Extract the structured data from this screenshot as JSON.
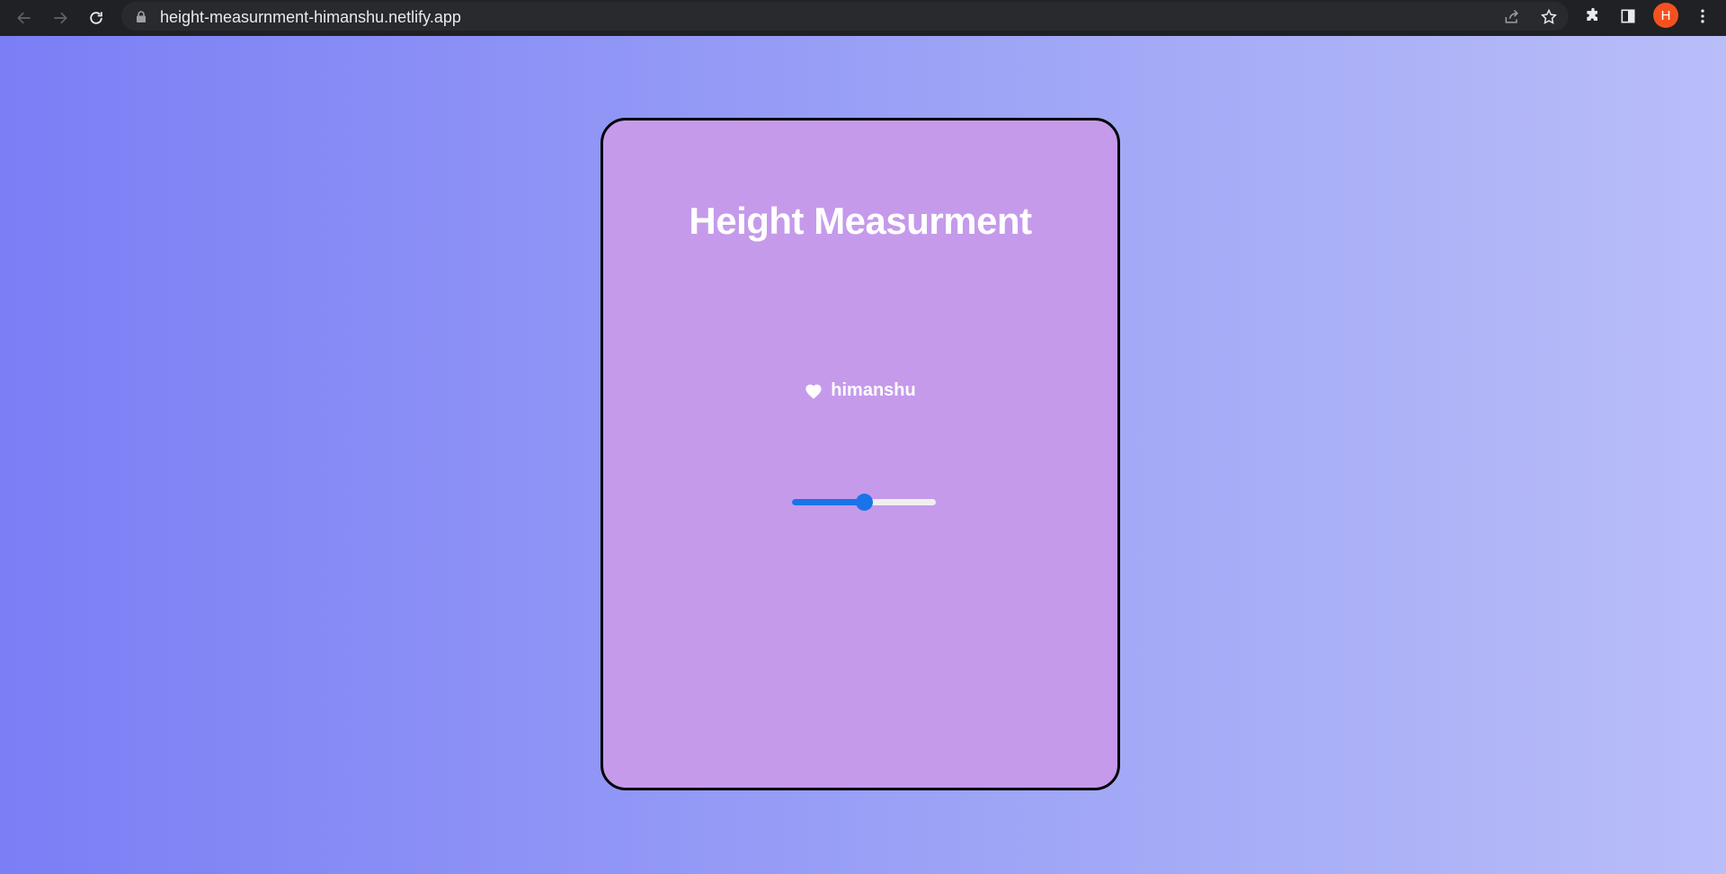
{
  "browser": {
    "url": "height-measurnment-himanshu.netlify.app",
    "profile_initial": "H",
    "icons": {
      "back": "arrow-left-icon",
      "forward": "arrow-right-icon",
      "reload": "reload-icon",
      "lock": "lock-icon",
      "share": "share-icon",
      "bookmark": "star-icon",
      "extensions": "puzzle-icon",
      "side_panel": "side-panel-icon",
      "menu": "kebab-menu-icon"
    }
  },
  "page": {
    "title": "Height Measurment",
    "credit_icon": "heart-icon",
    "credit_name": "himanshu",
    "slider": {
      "value_fraction": 0.5
    },
    "colors": {
      "gradient_start": "#7b7ef5",
      "gradient_end": "#b9bdf8",
      "card_background": "#c59aea",
      "card_border": "#000000",
      "slider_accent": "#1a73e8",
      "text": "#ffffff"
    }
  }
}
